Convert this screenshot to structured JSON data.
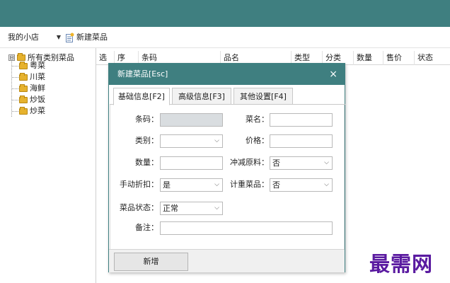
{
  "toolbar": {
    "shop_selected": "我的小店",
    "new_dish_label": "新建菜品"
  },
  "tree": {
    "root_label": "所有类别菜品",
    "expander": "⊟",
    "children": [
      {
        "label": "粤菜"
      },
      {
        "label": "川菜"
      },
      {
        "label": "海鲜"
      },
      {
        "label": "炒饭"
      },
      {
        "label": "炒菜"
      }
    ]
  },
  "grid": {
    "columns": [
      "选",
      "序",
      "条码",
      "品名",
      "类型",
      "分类",
      "数量",
      "售价",
      "状态"
    ]
  },
  "dialog": {
    "title": "新建菜品[Esc]",
    "close_glyph": "×",
    "tabs": [
      {
        "label": "基础信息[F2]",
        "active": true
      },
      {
        "label": "高级信息[F3]",
        "active": false
      },
      {
        "label": "其他设置[F4]",
        "active": false
      }
    ],
    "form": {
      "barcode_label": "条码：",
      "barcode_value": "",
      "name_label": "菜名：",
      "name_value": "",
      "category_label": "类别：",
      "category_value": "",
      "price_label": "价格：",
      "price_value": "",
      "quantity_label": "数量：",
      "quantity_value": "",
      "deduct_label": "冲减原料：",
      "deduct_value": "否",
      "manual_discount_label": "手动折扣：",
      "manual_discount_value": "是",
      "weighed_label": "计重菜品：",
      "weighed_value": "否",
      "status_label": "菜品状态：",
      "status_value": "正常",
      "remark_label": "备注：",
      "remark_value": ""
    },
    "add_button_label": "新增"
  },
  "watermark": "最需网",
  "colors": {
    "teal": "#3f7f80",
    "watermark": "#5a1aa0"
  },
  "icons": {
    "dropdown": "▾",
    "new_doc": "new-document-icon",
    "folder": "folder-icon"
  }
}
